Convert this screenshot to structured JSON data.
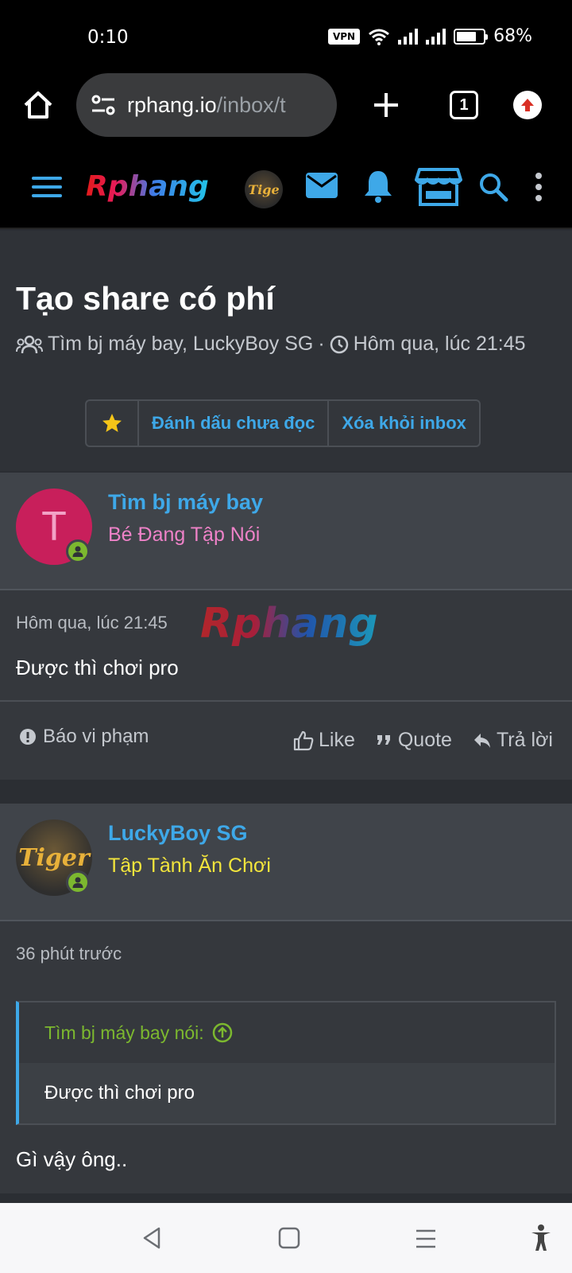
{
  "status": {
    "time": "0:10",
    "vpn": "VPN",
    "battery": "68%"
  },
  "browser": {
    "url_host": "rphang.io",
    "url_path": "/inbox/t",
    "tab_count": "1"
  },
  "site": {
    "logo": "Rphang",
    "watermark": "Rphang"
  },
  "thread": {
    "title": "Tạo share có phí",
    "participants": "Tìm bj máy bay, LuckyBoy SG",
    "separator": "·",
    "time": "Hôm qua, lúc 21:45",
    "mark_unread": "Đánh dấu chưa đọc",
    "remove_inbox": "Xóa khỏi inbox"
  },
  "messages": [
    {
      "avatar_letter": "T",
      "avatar_color": "#c81f5b",
      "username": "Tìm bj máy bay",
      "user_title": "Bé Đang Tập Nói",
      "user_title_color": "#ee82c8",
      "date": "Hôm qua, lúc 21:45",
      "body": "Được thì chơi pro"
    },
    {
      "avatar_text": "Tiger",
      "username": "LuckyBoy SG",
      "user_title": "Tập Tành Ăn Chơi",
      "user_title_color": "#f3e53c",
      "date": "36 phút trước",
      "quote_author": "Tìm bj máy bay nói:",
      "quote_body": "Được thì chơi pro",
      "body": "Gì vậy ông.."
    }
  ],
  "actions": {
    "report": "Báo vi phạm",
    "like": "Like",
    "quote": "Quote",
    "reply": "Trả lời"
  },
  "icons": [
    "home-icon",
    "site-settings-icon",
    "new-tab-icon",
    "tabs-icon",
    "update-icon",
    "menu-icon",
    "avatar",
    "mail-icon",
    "bell-icon",
    "store-icon",
    "search-icon",
    "more-icon",
    "users-icon",
    "clock-icon",
    "star-icon",
    "warning-icon",
    "thumbs-up-icon",
    "quote-icon",
    "reply-icon",
    "arrow-up-circle-icon",
    "back-icon",
    "home-square-icon",
    "recents-icon",
    "accessibility-icon"
  ]
}
